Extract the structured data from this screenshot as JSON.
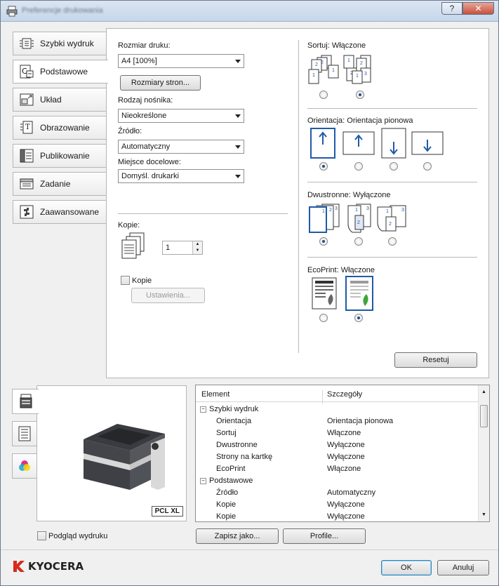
{
  "window": {
    "title": "Preferencje drukowania",
    "help_label": "?",
    "close_label": "✕"
  },
  "tabs": [
    {
      "label": "Szybki wydruk",
      "icon": "quick-print-icon"
    },
    {
      "label": "Podstawowe",
      "icon": "basic-icon"
    },
    {
      "label": "Układ",
      "icon": "layout-icon"
    },
    {
      "label": "Obrazowanie",
      "icon": "imaging-icon"
    },
    {
      "label": "Publikowanie",
      "icon": "publishing-icon"
    },
    {
      "label": "Zadanie",
      "icon": "job-icon"
    },
    {
      "label": "Zaawansowane",
      "icon": "advanced-icon"
    }
  ],
  "active_tab": "Podstawowe",
  "basic": {
    "print_size_label": "Rozmiar druku:",
    "print_size_value": "A4  [100%]",
    "page_sizes_button": "Rozmiary stron...",
    "media_type_label": "Rodzaj nośnika:",
    "media_type_value": "Nieokreślone",
    "source_label": "Źródło:",
    "source_value": "Automatyczny",
    "destination_label": "Miejsce docelowe:",
    "destination_value": "Domyśl. drukarki",
    "copies_label": "Kopie:",
    "copies_value": "1",
    "collate_label": "Kopie",
    "settings_button": "Ustawienia..."
  },
  "sort": {
    "label": "Sortuj:",
    "value": "Włączone",
    "selected_index": 1
  },
  "orientation": {
    "label": "Orientacja:",
    "value": "Orientacja pionowa",
    "selected_index": 0
  },
  "duplex": {
    "label": "Dwustronne:",
    "value": "Wyłączone",
    "selected_index": 0
  },
  "ecoprint": {
    "label": "EcoPrint:",
    "value": "Włączone",
    "selected_index": 1
  },
  "reset_button": "Resetuj",
  "preview": {
    "badge": "PCL XL",
    "print_preview_label": "Podgląd wydruku"
  },
  "summary": {
    "col_element": "Element",
    "col_details": "Szczegóły",
    "rows": [
      {
        "type": "group",
        "label": "Szybki wydruk",
        "expander": "−"
      },
      {
        "type": "item",
        "label": "Orientacja",
        "value": "Orientacja pionowa"
      },
      {
        "type": "item",
        "label": "Sortuj",
        "value": "Włączone"
      },
      {
        "type": "item",
        "label": "Dwustronne",
        "value": "Wyłączone"
      },
      {
        "type": "item",
        "label": "Strony na kartkę",
        "value": "Wyłączone"
      },
      {
        "type": "item",
        "label": "EcoPrint",
        "value": "Włączone"
      },
      {
        "type": "group",
        "label": "Podstawowe",
        "expander": "−"
      },
      {
        "type": "item",
        "label": "Źródło",
        "value": "Automatyczny"
      },
      {
        "type": "item",
        "label": "Kopie",
        "value": "Wyłączone"
      },
      {
        "type": "item",
        "label": "Kopie",
        "value": "Wyłączone"
      }
    ]
  },
  "bottom": {
    "save_as_button": "Zapisz jako...",
    "profile_button": "Profile...",
    "ok_button": "OK",
    "cancel_button": "Anuluj",
    "logo_text": "KYOCERA",
    "logo_color": "#d52b1e"
  }
}
